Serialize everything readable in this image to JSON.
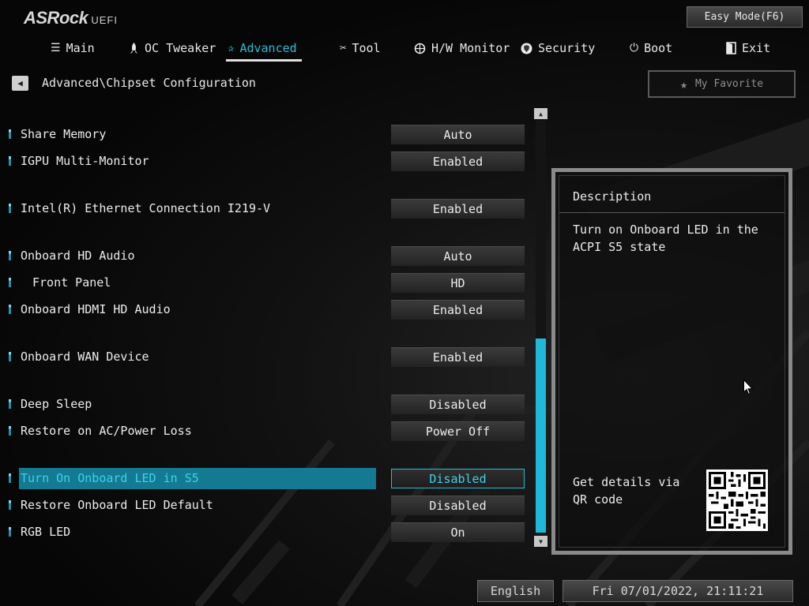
{
  "logo": {
    "brand": "ASRock",
    "suffix": "UEFI"
  },
  "easy_mode": {
    "label": "Easy Mode(F6)"
  },
  "nav": {
    "tabs": [
      {
        "id": "main",
        "label": "Main",
        "icon": "list-icon"
      },
      {
        "id": "oc",
        "label": "OC Tweaker",
        "icon": "rocket-icon"
      },
      {
        "id": "advanced",
        "label": "Advanced",
        "icon": "star-icon",
        "active": true
      },
      {
        "id": "tool",
        "label": "Tool",
        "icon": "tools-icon"
      },
      {
        "id": "hw",
        "label": "H/W Monitor",
        "icon": "monitor-icon"
      },
      {
        "id": "security",
        "label": "Security",
        "icon": "shield-icon"
      },
      {
        "id": "boot",
        "label": "Boot",
        "icon": "power-icon"
      },
      {
        "id": "exit",
        "label": "Exit",
        "icon": "exit-icon"
      }
    ]
  },
  "breadcrumb": {
    "path": "Advanced\\Chipset Configuration"
  },
  "favorite": {
    "label": "My Favorite"
  },
  "settings": [
    {
      "label": "Share Memory",
      "value": "Auto"
    },
    {
      "label": "IGPU Multi-Monitor",
      "value": "Enabled"
    },
    {
      "label": "Intel(R) Ethernet Connection I219-V",
      "value": "Enabled"
    },
    {
      "label": "Onboard HD Audio",
      "value": "Auto"
    },
    {
      "label": "Front Panel",
      "value": "HD",
      "sub": true
    },
    {
      "label": "Onboard HDMI HD Audio",
      "value": "Enabled"
    },
    {
      "label": "Onboard WAN Device",
      "value": "Enabled"
    },
    {
      "label": "Deep Sleep",
      "value": "Disabled"
    },
    {
      "label": "Restore on AC/Power Loss",
      "value": "Power Off"
    },
    {
      "label": "Turn On Onboard LED in S5",
      "value": "Disabled",
      "selected": true
    },
    {
      "label": "Restore Onboard LED Default",
      "value": "Disabled"
    },
    {
      "label": "RGB LED",
      "value": "On"
    }
  ],
  "description": {
    "title": "Description",
    "text": "Turn on Onboard LED in the ACPI S5 state",
    "qr_text": "Get details via QR code"
  },
  "footer": {
    "language": "English",
    "datetime": "Fri 07/01/2022, 21:11:21"
  },
  "colors": {
    "accent": "#2bbbd3",
    "selected_row": "#137a92",
    "scroll_thumb": "#1fb8d8",
    "panel_border": "#8a8a8a"
  }
}
